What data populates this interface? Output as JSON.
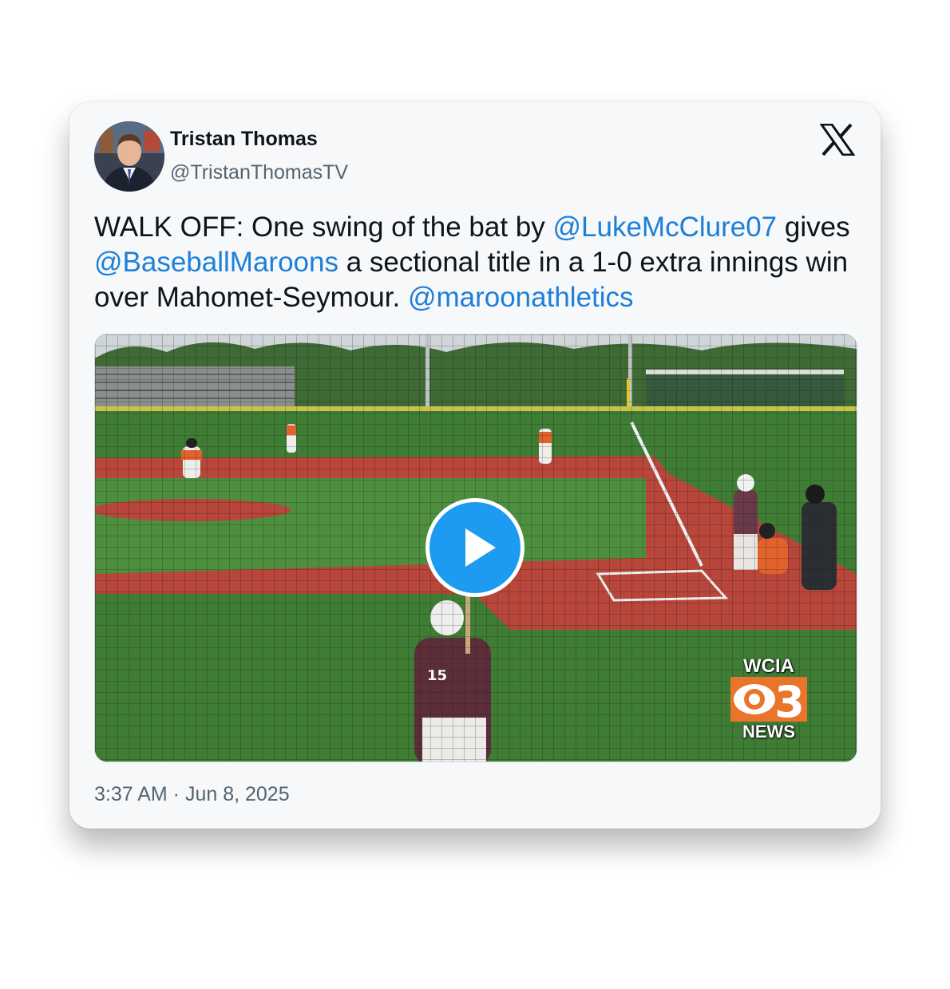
{
  "author": {
    "name": "Tristan Thomas",
    "handle": "@TristanThomasTV",
    "avatar_icon": "avatar-photo"
  },
  "platform_icon": "x-logo-icon",
  "tweet": {
    "part1": "WALK OFF: One swing of the bat by ",
    "mention1": "@LukeMcClure07",
    "part2": " gives ",
    "mention2": "@BaseballMaroons",
    "part3": " a sectional title in a 1-0 extra innings win over Mahomet-Seymour. ",
    "mention3": "@maroonathletics"
  },
  "video": {
    "play_icon": "play-icon",
    "player_number": "15",
    "network": {
      "top": "WCIA",
      "number": "3",
      "bottom": "NEWS"
    }
  },
  "timestamp": "3:37 AM · Jun 8, 2025",
  "colors": {
    "link": "#1d7fd8",
    "play_button": "#1d9bf0",
    "handle_gray": "#536471"
  }
}
